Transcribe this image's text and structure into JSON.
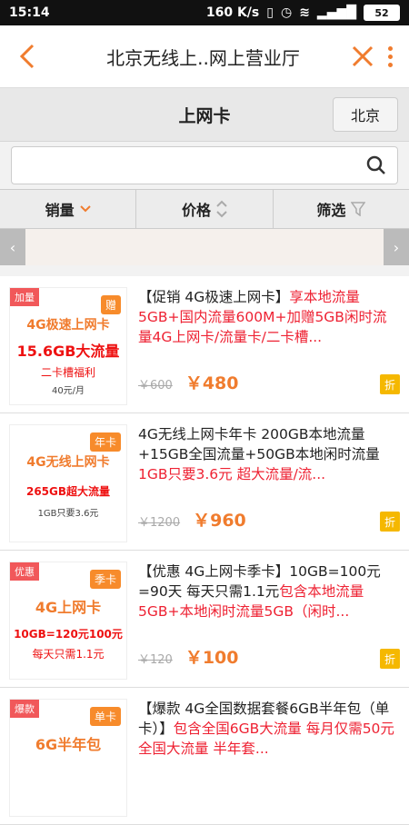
{
  "status_bar": {
    "time": "15:14",
    "speed": "160 K/s",
    "battery": "52"
  },
  "title_bar": {
    "title": "北京无线上..网上营业厅"
  },
  "sub_header": {
    "title": "上网卡",
    "city_button": "北京"
  },
  "search": {
    "placeholder": "",
    "value": ""
  },
  "sort_bar": {
    "items": [
      {
        "label": "销量",
        "icon": "chevron-down-icon"
      },
      {
        "label": "价格",
        "icon": "sort-updown-icon"
      },
      {
        "label": "筛选",
        "icon": "filter-icon"
      }
    ]
  },
  "products": [
    {
      "ribbon": "加量",
      "tag": "赠",
      "thumb_lines": [
        "4G极速上网卡",
        "15.6GB大流量",
        "二卡槽福利",
        "40元/月"
      ],
      "desc_black": "【促销 4G极速上网卡】",
      "desc_red": "享本地流量5GB+国内流量600M+加赠5GB闲时流量4G上网卡/流量卡/二卡槽...",
      "old_price": "￥600",
      "price": "￥480",
      "badge": "折"
    },
    {
      "ribbon": "",
      "tag": "年卡",
      "thumb_lines": [
        "4G无线上网卡",
        "265GB超大流量",
        "1GB只要3.6元",
        ""
      ],
      "desc_black": "4G无线上网卡年卡 200GB本地流量+15GB全国流量+50GB本地闲时流量",
      "desc_red": "1GB只要3.6元 超大流量/流...",
      "old_price": "￥1200",
      "price": "￥960",
      "badge": "折"
    },
    {
      "ribbon": "优惠",
      "tag": "季卡",
      "thumb_lines": [
        "4G上网卡",
        "10GB=120元100元",
        "每天只需1.1元",
        ""
      ],
      "desc_black": "【优惠 4G上网卡季卡】10GB=100元=90天 每天只需1.1元",
      "desc_red": "包含本地流量5GB+本地闲时流量5GB（闲时...",
      "old_price": "￥120",
      "price": "￥100",
      "badge": "折"
    },
    {
      "ribbon": "爆款",
      "tag": "单卡",
      "thumb_lines": [
        "6G半年包",
        "",
        "",
        ""
      ],
      "desc_black": "【爆款 4G全国数据套餐6GB半年包（单卡）】",
      "desc_red": "包含全国6GB大流量 每月仅需50元 全国大流量 半年套...",
      "old_price": "",
      "price": "",
      "badge": ""
    }
  ],
  "colors": {
    "accent": "#f07c2e",
    "price_red": "#e23",
    "badge_yellow": "#f5b800"
  }
}
